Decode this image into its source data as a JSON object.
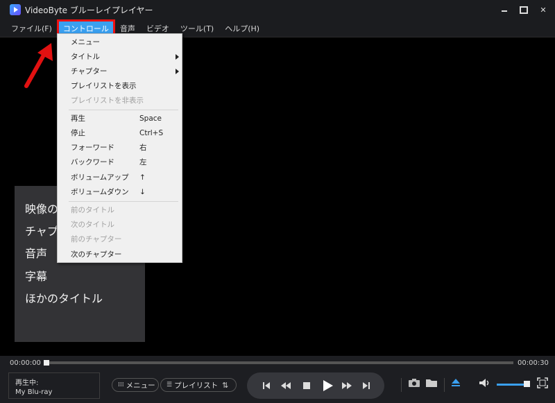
{
  "app": {
    "title": "VideoByte ブルーレイプレイヤー"
  },
  "menubar": {
    "items": [
      {
        "label": "ファイル(F)"
      },
      {
        "label": "コントロール"
      },
      {
        "label": "音声"
      },
      {
        "label": "ビデオ"
      },
      {
        "label": "ツール(T)"
      },
      {
        "label": "ヘルプ(H)"
      }
    ]
  },
  "control_menu": {
    "items": [
      {
        "label": "メニュー"
      },
      {
        "label": "タイトル"
      },
      {
        "label": "チャプター"
      },
      {
        "label": "プレイリストを表示"
      },
      {
        "label": "プレイリストを非表示"
      },
      {
        "label": "再生",
        "shortcut": "Space"
      },
      {
        "label": "停止",
        "shortcut": "Ctrl+S"
      },
      {
        "label": "フォーワード",
        "shortcut": "右"
      },
      {
        "label": "バックワード",
        "shortcut": "左"
      },
      {
        "label": "ボリュームアップ",
        "shortcut": "↑"
      },
      {
        "label": "ボリュームダウン",
        "shortcut": "↓"
      },
      {
        "label": "前のタイトル"
      },
      {
        "label": "次のタイトル"
      },
      {
        "label": "前のチャプター"
      },
      {
        "label": "次のチャプター"
      }
    ]
  },
  "disc_menu": {
    "items": [
      {
        "label": "映像の"
      },
      {
        "label": "チャプ"
      },
      {
        "label": "音声"
      },
      {
        "label": "字幕"
      },
      {
        "label": "ほかのタイトル"
      }
    ]
  },
  "player": {
    "time_current": "00:00:00",
    "time_total": "00:00:30",
    "now_playing_label": "再生中:",
    "now_playing_title": "My Blu-ray",
    "menu_button": "メニュー",
    "playlist_button": "プレイリスト"
  },
  "colors": {
    "accent": "#3aa0f0",
    "highlight_border": "#e11111",
    "annotation_arrow": "#e11111"
  }
}
